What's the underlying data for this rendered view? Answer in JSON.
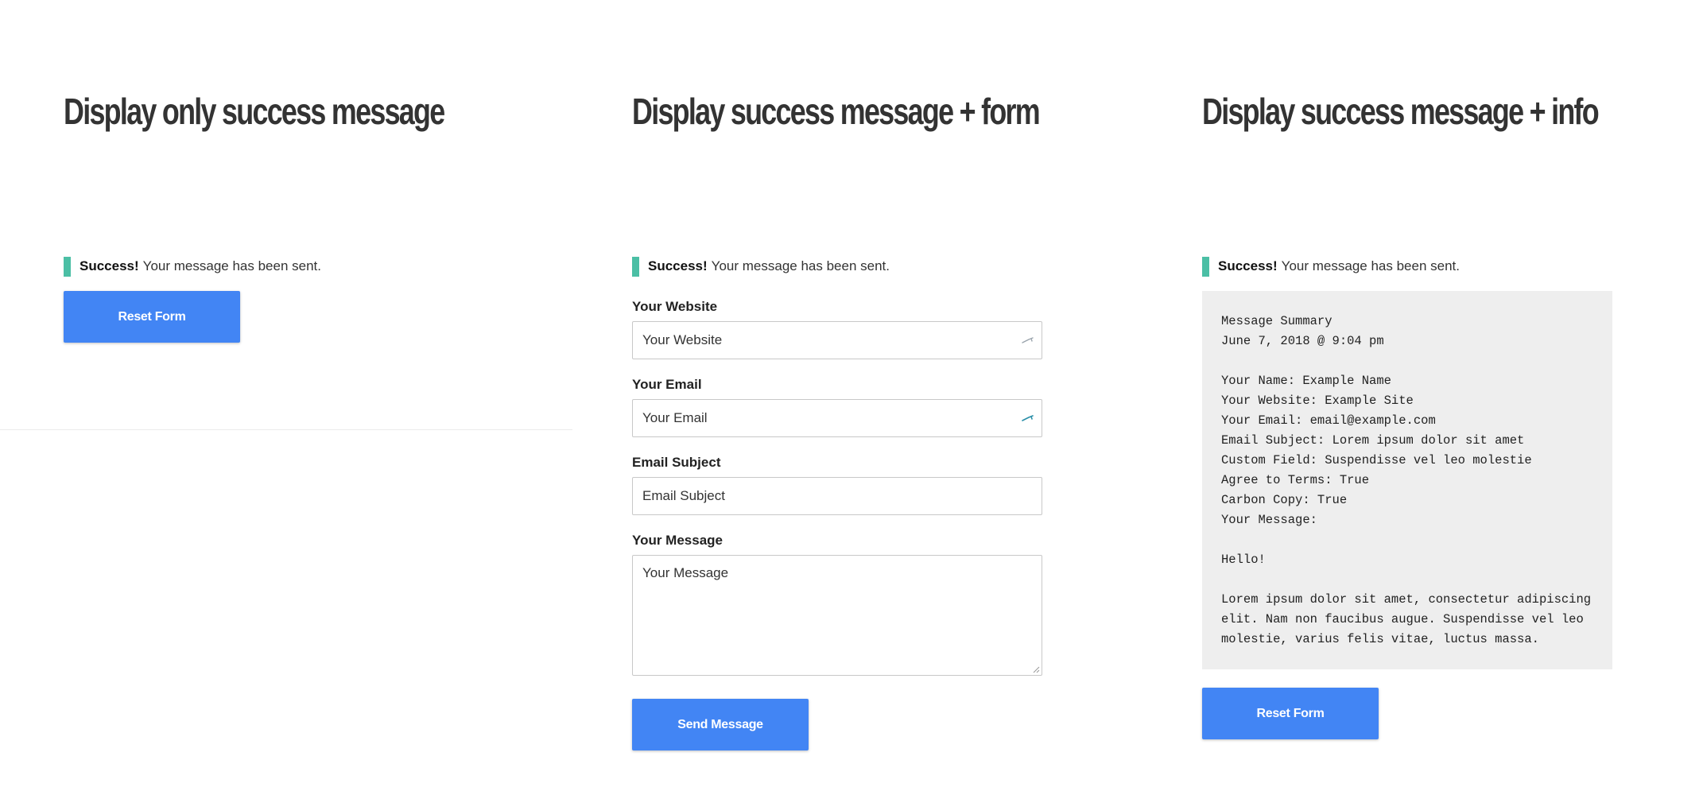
{
  "columns": [
    {
      "heading": "Display only success message",
      "success_strong": "Success!",
      "success_text": "Your message has been sent.",
      "button_label": "Reset Form"
    },
    {
      "heading": "Display success message + form",
      "success_strong": "Success!",
      "success_text": "Your message has been sent.",
      "fields": [
        {
          "label": "Your Website",
          "placeholder": "Your Website",
          "value": "",
          "icon": "autofill-key-icon"
        },
        {
          "label": "Your Email",
          "placeholder": "Your Email",
          "value": "",
          "icon": "autofill-key-icon"
        },
        {
          "label": "Email Subject",
          "placeholder": "Email Subject",
          "value": ""
        },
        {
          "label": "Your Message",
          "placeholder": "Your Message",
          "value": ""
        }
      ],
      "button_label": "Send Message"
    },
    {
      "heading": "Display success message + info",
      "success_strong": "Success!",
      "success_text": "Your message has been sent.",
      "summary_lines": [
        "Message Summary",
        "June 7, 2018 @ 9:04 pm",
        "",
        "Your Name: Example Name",
        "Your Website: Example Site",
        "Your Email: email@example.com",
        "Email Subject: Lorem ipsum dolor sit amet",
        "Custom Field: Suspendisse vel leo molestie",
        "Agree to Terms: True",
        "Carbon Copy: True",
        "Your Message:",
        "",
        "Hello!",
        "",
        "Lorem ipsum dolor sit amet, consectetur adipiscing",
        "elit. Nam non faucibus augue. Suspendisse vel leo",
        "molestie, varius felis vitae, luctus massa."
      ],
      "button_label": "Reset Form"
    }
  ],
  "colors": {
    "accent_button": "#4285f4",
    "success_bar": "#4bbfa5",
    "summary_background": "#eeeeee",
    "heading_text": "#333333"
  }
}
